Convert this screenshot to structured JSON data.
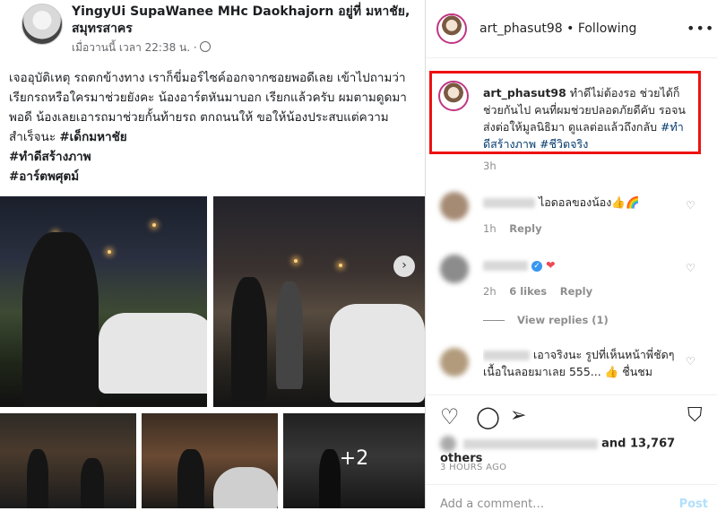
{
  "facebook_post": {
    "author": "YingyUi SupaWanee MHc Daokhajorn อยู่ที่ มหาชัย, สมุทรสาคร",
    "timestamp": "เมื่อวานนี้ เวลา 22:38 น. ·",
    "body": "เจออุบัติเหตุ รถตกข้างทาง เราก็ขี่มอร์ไซค์ออกจากซอยพอดีเลย เข้าไปถามว่า เรียกรถหรือใครมาช่วยยังคะ น้องอาร์ตหันมาบอก เรียกแล้วครับ ผมตามดูดมาพอดี น้องเลยเอารถมาช่วยกั้นท้ายรถ ตกถนนให้  ขอให้น้องประสบแต่ความสำเร็จนะ",
    "hashtags": [
      "#เด็กมหาชัย",
      "#ทำดีสร้างภาพ",
      "#อาร์ตพศุตม์"
    ],
    "more_photos": "+2"
  },
  "instagram": {
    "header": {
      "username": "art_phasut98",
      "separator": " • ",
      "follow_status": "Following"
    },
    "caption": {
      "username": "art_phasut98",
      "text": "ทำดีไม่ต้องรอ ช่วยได้ก็ช่วยกันไป คนที่ผมช่วยปลอดภัยดีคับ รอจน ส่งต่อให้มูลนิธิมา ดูแลต่อแล้วถึงกลับ",
      "hashtags": [
        "#ทำดีสร้างภาพ",
        "#ชีวิตจริง"
      ],
      "time": "3h"
    },
    "comments": [
      {
        "text": "ไอดอลของน้อง👍🌈",
        "time": "1h",
        "reply_label": "Reply"
      },
      {
        "text": "❤",
        "time": "2h",
        "likes": "6 likes",
        "reply_label": "Reply",
        "view_replies": "View replies (1)"
      },
      {
        "text": "เอาจริงนะ รูปที่เห็นหน้าพี่ชัดๆ เนื้อในลอยมาเลย 555... 👍",
        "text_tail": "ชื่นชม"
      }
    ],
    "likes_suffix": "and 13,767 others",
    "posted_ago": "3 HOURS AGO",
    "add_comment_placeholder": "Add a comment…",
    "post_label": "Post"
  },
  "icons": [
    "globe-icon",
    "next-arrow-icon",
    "more-options-icon",
    "heart-icon",
    "comment-icon",
    "share-icon",
    "bookmark-icon",
    "verified-icon"
  ]
}
